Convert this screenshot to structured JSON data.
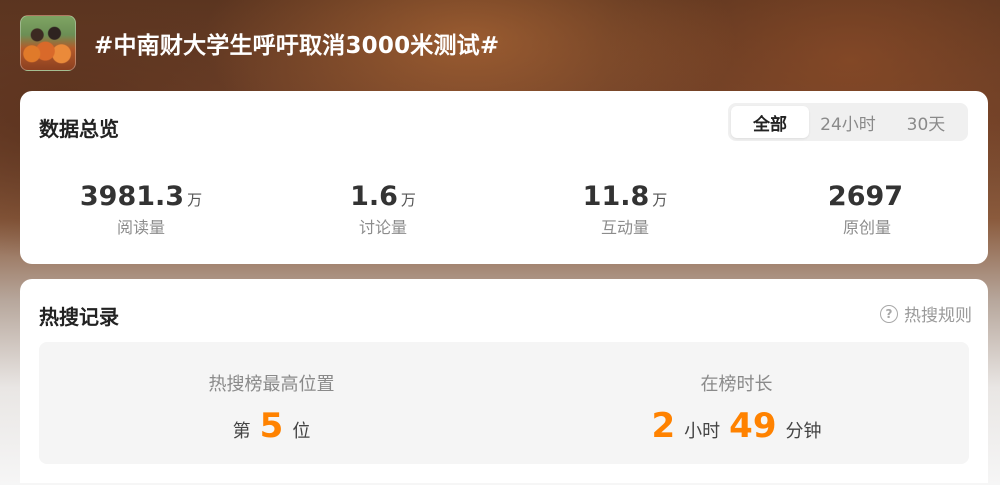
{
  "topic": {
    "title": "#中南财大学生呼吁取消3000米测试#"
  },
  "overview": {
    "title": "数据总览",
    "tabs": [
      "全部",
      "24小时",
      "30天"
    ],
    "active_tab": "全部",
    "stats": [
      {
        "value": "3981.3",
        "unit": "万",
        "label": "阅读量"
      },
      {
        "value": "1.6",
        "unit": "万",
        "label": "讨论量"
      },
      {
        "value": "11.8",
        "unit": "万",
        "label": "互动量"
      },
      {
        "value": "2697",
        "unit": "",
        "label": "原创量"
      }
    ]
  },
  "hot_search": {
    "title": "热搜记录",
    "rules_label": "热搜规则",
    "highest_position": {
      "label": "热搜榜最高位置",
      "prefix": "第",
      "value": "5",
      "suffix": "位"
    },
    "duration": {
      "label": "在榜时长",
      "hours": "2",
      "hours_unit": "小时",
      "minutes": "49",
      "minutes_unit": "分钟"
    }
  },
  "colors": {
    "accent": "#ff8200",
    "title_text": "#ffffff"
  }
}
